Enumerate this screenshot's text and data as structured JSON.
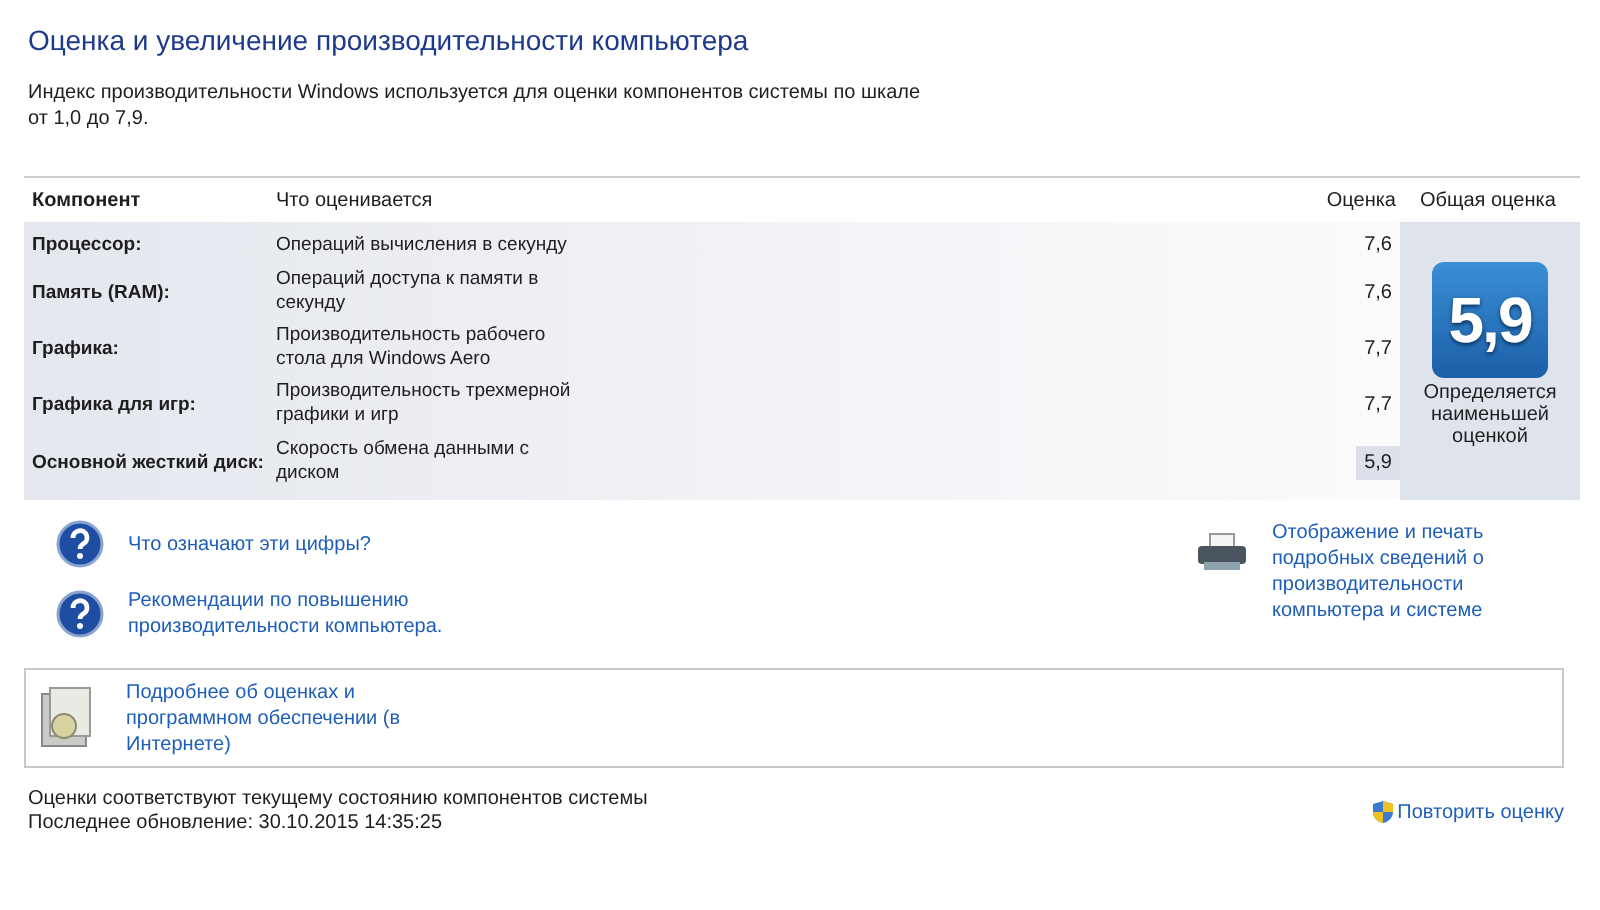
{
  "title": "Оценка и увеличение производительности компьютера",
  "description": "Индекс производительности Windows используется для оценки компонентов системы по шкале от 1,0 до 7,9.",
  "table": {
    "columns": [
      "Компонент",
      "Что оценивается",
      "Оценка",
      "Общая оценка"
    ],
    "rows": [
      {
        "component": "Процессор:",
        "measures": "Операций вычисления в секунду",
        "score": "7,6",
        "lowest": false
      },
      {
        "component": "Память (RAM):",
        "measures": "Операций доступа к памяти в секунду",
        "score": "7,6",
        "lowest": false
      },
      {
        "component": "Графика:",
        "measures": "Производительность рабочего стола для Windows Aero",
        "score": "7,7",
        "lowest": false
      },
      {
        "component": "Графика для игр:",
        "measures": "Производительность трехмерной графики и игр",
        "score": "7,7",
        "lowest": false
      },
      {
        "component": "Основной жесткий диск:",
        "measures": "Скорость обмена данными с диском",
        "score": "5,9",
        "lowest": true
      }
    ],
    "overall": {
      "score": "5,9",
      "caption": "Определяется наименьшей оценкой"
    }
  },
  "help_links": [
    "Что означают эти цифры?",
    "Рекомендации по повышению производительности компьютера."
  ],
  "print_link": "Отображение и печать подробных сведений о производительности компьютера и системе",
  "online_link": "Подробнее об оценках и программном обеспечении (в Интернете)",
  "status": [
    "Оценки соответствуют текущему состоянию компонентов системы",
    "Последнее обновление: 30.10.2015 14:35:25"
  ],
  "rerun_link": "Повторить оценку"
}
